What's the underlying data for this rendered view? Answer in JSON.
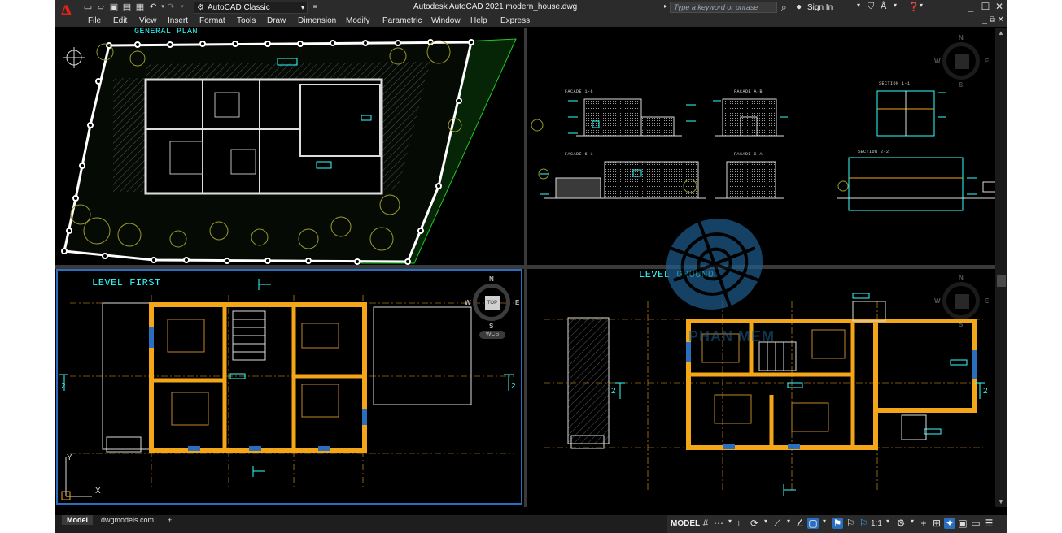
{
  "window": {
    "title": "Autodesk AutoCAD 2021   modern_house.dwg",
    "workspace": "AutoCAD Classic",
    "search_placeholder": "Type a keyword or phrase",
    "sign_in": "Sign In"
  },
  "menu": [
    "File",
    "Edit",
    "View",
    "Insert",
    "Format",
    "Tools",
    "Draw",
    "Dimension",
    "Modify",
    "Parametric",
    "Window",
    "Help",
    "Express"
  ],
  "viewports": {
    "top_left": {
      "title": "GENERAL PLAN"
    },
    "top_right": {
      "labels": [
        "FACADE 1-6",
        "FACADE A-B",
        "SECTION 1-1",
        "FACADE 6-1",
        "FACADE C-A",
        "SECTION 2-2"
      ]
    },
    "bottom_left": {
      "title": "LEVEL FIRST"
    },
    "bottom_right": {
      "title": "LEVEL GROUND"
    }
  },
  "viewcube": {
    "n": "N",
    "s": "S",
    "e": "E",
    "w": "W",
    "face": "TOP",
    "wcs": "WCS"
  },
  "axes": {
    "x": "X",
    "y": "Y"
  },
  "grid_marks": {
    "two": "2",
    "one": "1"
  },
  "tabs": {
    "model": "Model",
    "layout": "dwgmodels.com",
    "add": "+"
  },
  "status": {
    "model": "MODEL",
    "scale": "1:1"
  },
  "watermark": "PHAN MEM",
  "colors": {
    "titlebar": "#2b2b2b",
    "canvas": "#000000",
    "cyan": "#33ffff",
    "wall_orange": "#f2a618",
    "active_border": "#2a6ebd",
    "green": "#22cc22",
    "autocad_red": "#e2231a"
  }
}
